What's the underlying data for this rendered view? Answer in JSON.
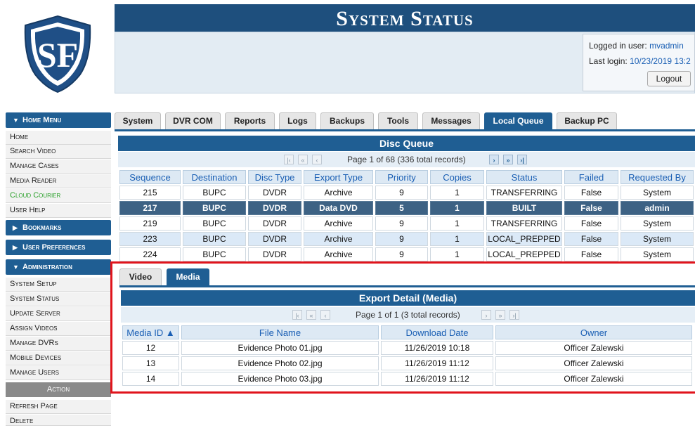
{
  "logo": {
    "text": "SF"
  },
  "header": {
    "title": "System Status",
    "logged_in_label": "Logged in user:",
    "logged_in_user": "mvadmin",
    "last_login_label": "Last login:",
    "last_login_value": "10/23/2019 13:2",
    "logout_label": "Logout"
  },
  "nav": {
    "home_menu": "Home Menu",
    "home_items": [
      "Home",
      "Search Video",
      "Manage Cases",
      "Media Reader",
      "Cloud Courier",
      "User Help"
    ],
    "bookmarks": "Bookmarks",
    "user_preferences": "User Preferences",
    "administration": "Administration",
    "admin_items": [
      "System Setup",
      "System Status",
      "Update Server",
      "Assign Videos",
      "Manage DVRs",
      "Mobile Devices",
      "Manage Users"
    ],
    "action": "Action",
    "action_items": [
      "Refresh Page",
      "Delete"
    ]
  },
  "tabs": [
    "System",
    "DVR COM",
    "Reports",
    "Logs",
    "Backups",
    "Tools",
    "Messages",
    "Local Queue",
    "Backup PC"
  ],
  "active_tab": "Local Queue",
  "disc_queue": {
    "title": "Disc Queue",
    "pager_text": "Page 1 of 68 (336 total records)",
    "columns": [
      "Sequence",
      "Destination",
      "Disc Type",
      "Export Type",
      "Priority",
      "Copies",
      "Status",
      "Failed",
      "Requested By"
    ],
    "rows": [
      [
        "215",
        "BUPC",
        "DVDR",
        "Archive",
        "9",
        "1",
        "TRANSFERRING",
        "False",
        "System"
      ],
      [
        "217",
        "BUPC",
        "DVDR",
        "Data DVD",
        "5",
        "1",
        "BUILT",
        "False",
        "admin"
      ],
      [
        "219",
        "BUPC",
        "DVDR",
        "Archive",
        "9",
        "1",
        "TRANSFERRING",
        "False",
        "System"
      ],
      [
        "223",
        "BUPC",
        "DVDR",
        "Archive",
        "9",
        "1",
        "LOCAL_PREPPED",
        "False",
        "System"
      ],
      [
        "224",
        "BUPC",
        "DVDR",
        "Archive",
        "9",
        "1",
        "LOCAL_PREPPED",
        "False",
        "System"
      ]
    ]
  },
  "export_detail": {
    "subtabs": [
      "Video",
      "Media"
    ],
    "active_subtab": "Media",
    "title": "Export Detail (Media)",
    "pager_text": "Page 1 of 1 (3 total records)",
    "columns": [
      "Media ID ▲",
      "File Name",
      "Download Date",
      "Owner"
    ],
    "rows": [
      [
        "12",
        "Evidence Photo 01.jpg",
        "11/26/2019 10:18",
        "Officer Zalewski"
      ],
      [
        "13",
        "Evidence Photo 02.jpg",
        "11/26/2019 11:12",
        "Officer Zalewski"
      ],
      [
        "14",
        "Evidence Photo 03.jpg",
        "11/26/2019 11:12",
        "Officer Zalewski"
      ]
    ]
  },
  "pager_icons": [
    "first-page-icon",
    "prev-block-icon",
    "prev-page-icon",
    "next-page-icon",
    "next-block-icon",
    "last-page-icon"
  ],
  "colors": {
    "brand_blue": "#1f5e93",
    "highlight_red": "#e0141c",
    "link_blue": "#1a5fb4"
  }
}
